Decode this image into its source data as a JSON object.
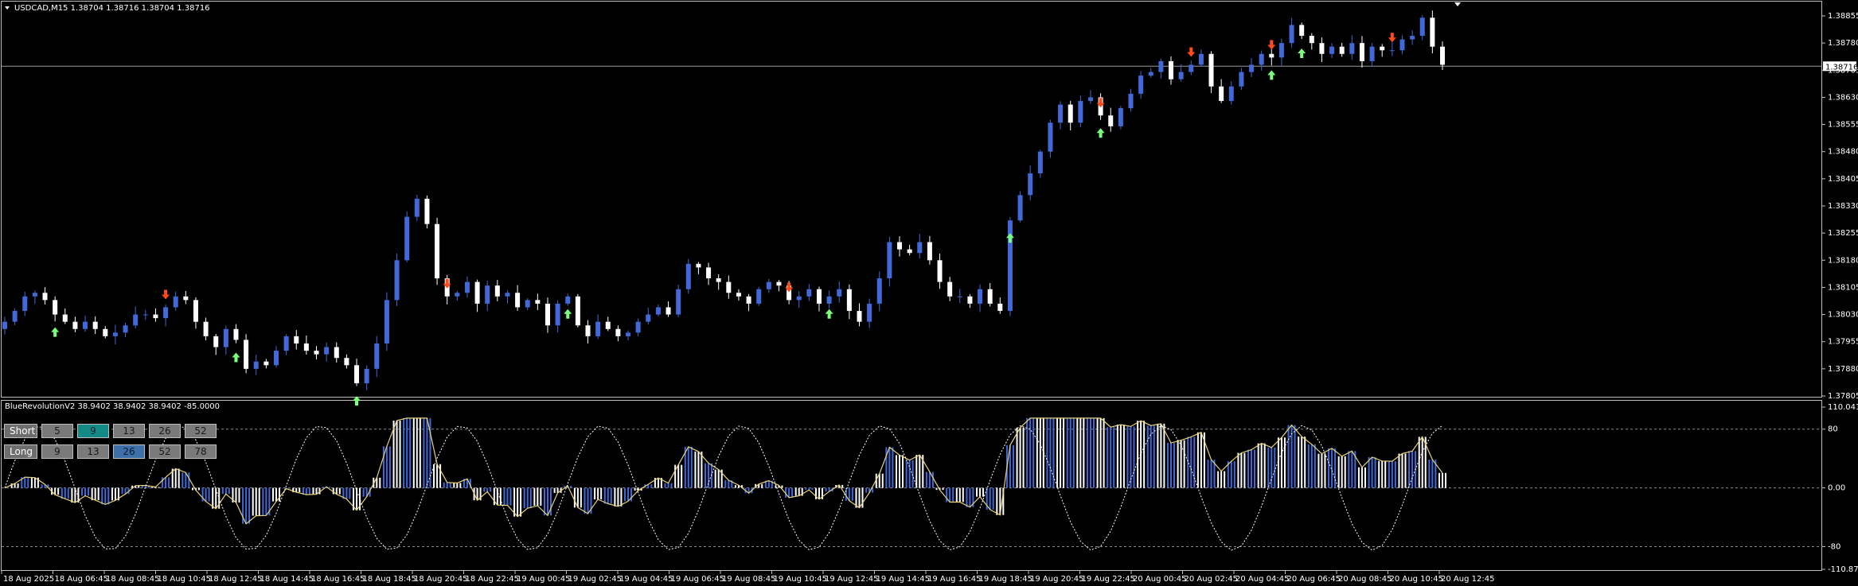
{
  "chart_header": {
    "title": "USDCAD,M15  1.38704 1.38716 1.38704 1.38716"
  },
  "indicator_header": {
    "title": "BlueRevolutionV2 38.9402 38.9402 38.9402 -85.0000"
  },
  "colors": {
    "bull": "#4169d8",
    "bear": "#ffffff",
    "up_arrow": "#7cff7c",
    "down_arrow": "#ff4a1a",
    "osc_line": "#e8d27a",
    "grid": "#bfbfbf"
  },
  "price_axis": {
    "labels": [
      "1.38855",
      "1.38780",
      "1.38705",
      "1.38630",
      "1.38555",
      "1.38480",
      "1.38405",
      "1.38330",
      "1.38255",
      "1.38180",
      "1.38105",
      "1.38030",
      "1.37955",
      "1.37880",
      "1.37805"
    ],
    "current_price_label": "1.38716"
  },
  "indicator_axis": {
    "labels": [
      "110.0417",
      "80",
      "0.00",
      "-80",
      "-110.875"
    ]
  },
  "time_axis": {
    "labels": [
      "18 Aug 2025",
      "18 Aug 06:45",
      "18 Aug 08:45",
      "18 Aug 10:45",
      "18 Aug 12:45",
      "18 Aug 14:45",
      "18 Aug 16:45",
      "18 Aug 18:45",
      "18 Aug 20:45",
      "18 Aug 22:45",
      "19 Aug 00:45",
      "19 Aug 02:45",
      "19 Aug 04:45",
      "19 Aug 06:45",
      "19 Aug 08:45",
      "19 Aug 10:45",
      "19 Aug 12:45",
      "19 Aug 14:45",
      "19 Aug 16:45",
      "19 Aug 18:45",
      "19 Aug 20:45",
      "19 Aug 22:45",
      "20 Aug 00:45",
      "20 Aug 02:45",
      "20 Aug 04:45",
      "20 Aug 06:45",
      "20 Aug 08:45",
      "20 Aug 10:45",
      "20 Aug 12:45"
    ]
  },
  "panel": {
    "short": {
      "label": "Short",
      "values": [
        "5",
        "9",
        "13",
        "26",
        "52"
      ],
      "selected": "9"
    },
    "long": {
      "label": "Long",
      "values": [
        "9",
        "13",
        "26",
        "52",
        "78"
      ],
      "selected": "26"
    }
  },
  "chart_data": {
    "type": "candlestick",
    "symbol": "USDCAD",
    "timeframe": "M15",
    "ylim": [
      1.37805,
      1.38855
    ],
    "close": [
      1.3801,
      1.3804,
      1.3808,
      1.3809,
      1.3807,
      1.3803,
      1.3801,
      1.3799,
      1.3801,
      1.3799,
      1.3797,
      1.3798,
      1.38,
      1.3803,
      1.3803,
      1.3802,
      1.3805,
      1.3808,
      1.3807,
      1.3801,
      1.3797,
      1.3794,
      1.3799,
      1.3796,
      1.3788,
      1.379,
      1.3789,
      1.3793,
      1.3797,
      1.3795,
      1.3793,
      1.3792,
      1.3794,
      1.3791,
      1.3789,
      1.3784,
      1.3788,
      1.3795,
      1.3807,
      1.3818,
      1.383,
      1.3835,
      1.3828,
      1.3813,
      1.3808,
      1.3809,
      1.3812,
      1.3806,
      1.3811,
      1.3808,
      1.3809,
      1.3805,
      1.3807,
      1.3806,
      1.38,
      1.3806,
      1.3808,
      1.38,
      1.3797,
      1.3801,
      1.3799,
      1.3797,
      1.3798,
      1.3801,
      1.3803,
      1.3805,
      1.3803,
      1.381,
      1.3817,
      1.3816,
      1.3813,
      1.3812,
      1.3809,
      1.3808,
      1.3806,
      1.381,
      1.3812,
      1.3811,
      1.3807,
      1.3808,
      1.381,
      1.3806,
      1.3808,
      1.381,
      1.3804,
      1.3801,
      1.3806,
      1.3813,
      1.3823,
      1.3821,
      1.382,
      1.3823,
      1.3818,
      1.3812,
      1.3808,
      1.3808,
      1.3806,
      1.381,
      1.3806,
      1.3804,
      1.3829,
      1.3836,
      1.3842,
      1.3848,
      1.3856,
      1.3861,
      1.3856,
      1.3862,
      1.3863,
      1.3858,
      1.3855,
      1.386,
      1.3864,
      1.3869,
      1.387,
      1.3873,
      1.3868,
      1.387,
      1.3872,
      1.3875,
      1.3866,
      1.3862,
      1.3866,
      1.387,
      1.3872,
      1.3875,
      1.3874,
      1.3878,
      1.3883,
      1.388,
      1.3878,
      1.3875,
      1.3877,
      1.3875,
      1.3878,
      1.3873,
      1.3877,
      1.3876,
      1.3876,
      1.3879,
      1.388,
      1.3885,
      1.3877,
      1.3872
    ]
  },
  "signals": {
    "up_arrow_count": 9,
    "down_arrow_count": 8
  }
}
